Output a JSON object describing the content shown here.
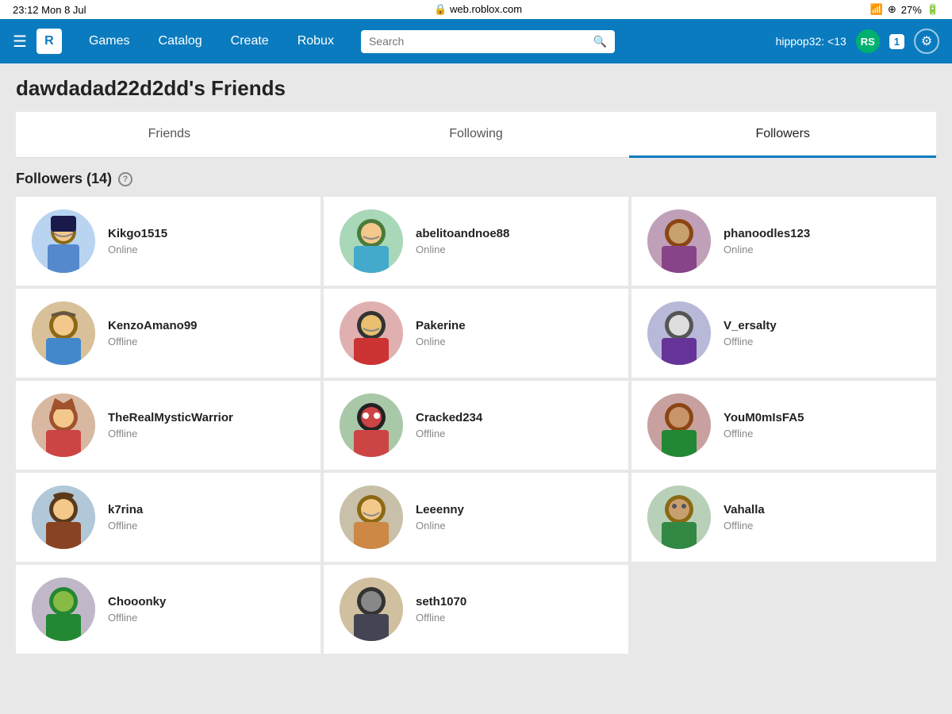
{
  "statusBar": {
    "time": "23:12",
    "date": "Mon 8 Jul",
    "battery": "27%",
    "url": "web.roblox.com"
  },
  "navbar": {
    "logo": "R",
    "links": [
      "Games",
      "Catalog",
      "Create",
      "Robux"
    ],
    "search": {
      "placeholder": "Search"
    },
    "username": "hippop32: <13",
    "robuxSymbol": "RS",
    "notifications": "1"
  },
  "page": {
    "title": "dawdadad22d2dd's Friends",
    "tabs": [
      {
        "label": "Friends",
        "active": false
      },
      {
        "label": "Following",
        "active": false
      },
      {
        "label": "Followers",
        "active": true
      }
    ],
    "section": {
      "heading": "Followers (14)",
      "helpTooltip": "?"
    },
    "followers": [
      {
        "name": "Kikgo1515",
        "status": "Online",
        "avatarClass": "av-1",
        "emoji": "🧑"
      },
      {
        "name": "abelitoandnoe88",
        "status": "Online",
        "avatarClass": "av-2",
        "emoji": "🧑"
      },
      {
        "name": "phanoodles123",
        "status": "Online",
        "avatarClass": "av-3",
        "emoji": "🦌"
      },
      {
        "name": "KenzoAmano99",
        "status": "Offline",
        "avatarClass": "av-4",
        "emoji": "🧑"
      },
      {
        "name": "Pakerine",
        "status": "Online",
        "avatarClass": "av-5",
        "emoji": "🧑"
      },
      {
        "name": "V_ersalty",
        "status": "Offline",
        "avatarClass": "av-6",
        "emoji": "🧑"
      },
      {
        "name": "TheRealMysticWarrior",
        "status": "Offline",
        "avatarClass": "av-7",
        "emoji": "🦌"
      },
      {
        "name": "Cracked234",
        "status": "Offline",
        "avatarClass": "av-8",
        "emoji": "🎩"
      },
      {
        "name": "YouM0mIsFA5",
        "status": "Offline",
        "avatarClass": "av-9",
        "emoji": "🧑"
      },
      {
        "name": "k7rina",
        "status": "Offline",
        "avatarClass": "av-10",
        "emoji": "🤠"
      },
      {
        "name": "Leeenny",
        "status": "Online",
        "avatarClass": "av-11",
        "emoji": "🧑"
      },
      {
        "name": "Vahalla",
        "status": "Offline",
        "avatarClass": "av-12",
        "emoji": "🧑"
      },
      {
        "name": "Chooonky",
        "status": "Offline",
        "avatarClass": "av-13",
        "emoji": "🧑"
      },
      {
        "name": "seth1070",
        "status": "Offline",
        "avatarClass": "av-14",
        "emoji": "🪖"
      }
    ]
  }
}
